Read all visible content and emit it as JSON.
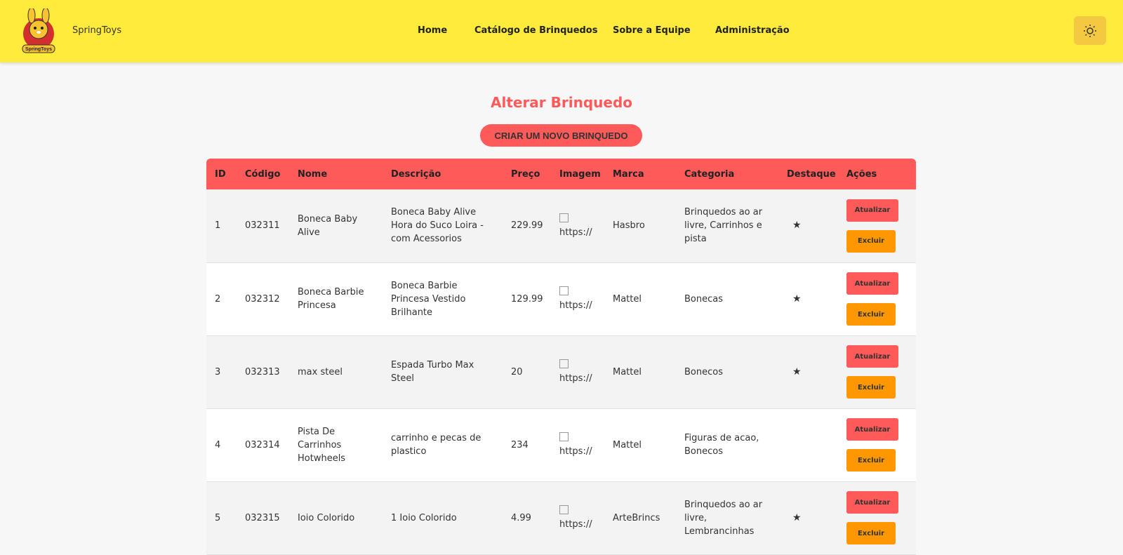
{
  "header": {
    "brand": "SpringToys",
    "logo_text": "SpringToys",
    "nav": [
      "Home",
      "Catálogo de Brinquedos",
      "Sobre a Equipe",
      "Administração"
    ]
  },
  "main": {
    "title": "Alterar Brinquedo",
    "new_button": "CRIAR UM NOVO BRINQUEDO"
  },
  "table": {
    "headers": [
      "ID",
      "Código",
      "Nome",
      "Descrição",
      "Preço",
      "Imagem",
      "Marca",
      "Categoria",
      "Destaque",
      "Ações"
    ],
    "update_label": "Atualizar",
    "delete_label": "Excluir",
    "rows": [
      {
        "id": "1",
        "code": "032311",
        "name": "Boneca Baby Alive",
        "desc": "Boneca Baby Alive Hora do Suco Loira - com Acessorios",
        "price": "229.99",
        "image": "https://",
        "brand": "Hasbro",
        "category": "Brinquedos ao ar livre, Carrinhos e pista",
        "featured": "★"
      },
      {
        "id": "2",
        "code": "032312",
        "name": "Boneca Barbie Princesa",
        "desc": "Boneca Barbie Princesa Vestido Brilhante",
        "price": "129.99",
        "image": "https://",
        "brand": "Mattel",
        "category": "Bonecas",
        "featured": "★"
      },
      {
        "id": "3",
        "code": "032313",
        "name": "max steel",
        "desc": "Espada Turbo Max Steel",
        "price": "20",
        "image": "https://",
        "brand": "Mattel",
        "category": "Bonecos",
        "featured": "★"
      },
      {
        "id": "4",
        "code": "032314",
        "name": "Pista De Carrinhos Hotwheels",
        "desc": "carrinho e pecas de plastico",
        "price": "234",
        "image": "https://",
        "brand": "Mattel",
        "category": "Figuras de acao, Bonecos",
        "featured": ""
      },
      {
        "id": "5",
        "code": "032315",
        "name": "Ioio Colorido",
        "desc": "1 Ioio Colorido",
        "price": "4.99",
        "image": "https://",
        "brand": "ArteBrincs",
        "category": "Brinquedos ao ar livre, Lembrancinhas",
        "featured": "★"
      }
    ]
  },
  "colors": {
    "header_bg": "#ffeb3b",
    "accent_red": "#ff5a5a",
    "accent_orange": "#ff9800"
  }
}
